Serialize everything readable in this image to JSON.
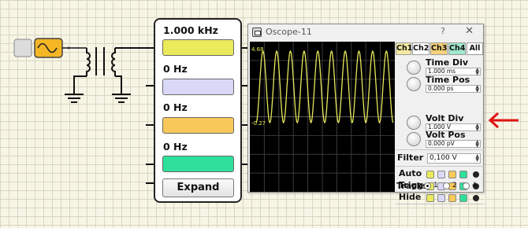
{
  "freq_panel": {
    "channels": [
      {
        "label": "1.000 kHz",
        "color": "#eaea5a"
      },
      {
        "label": "0 Hz",
        "color": "#d9d9f7"
      },
      {
        "label": "0 Hz",
        "color": "#f9c85a"
      },
      {
        "label": "0 Hz",
        "color": "#2ee09a"
      }
    ],
    "expand_label": "Expand"
  },
  "oscope": {
    "title": "Oscope-11",
    "help": "?",
    "close": "✕",
    "screen": {
      "top_value": "4.68",
      "bottom_value": "-0.27",
      "trace_color": "#e5e85a",
      "cycles": 10
    },
    "channels": [
      {
        "label": "Ch1",
        "color": "#f3e9a0"
      },
      {
        "label": "Ch2",
        "color": "#ffffff"
      },
      {
        "label": "Ch3",
        "color": "#f7d27a"
      },
      {
        "label": "Ch4",
        "color": "#9fe8c9"
      },
      {
        "label": "All",
        "color": "#ffffff"
      }
    ],
    "time_div": {
      "label": "Time Div",
      "value": "1.000 ms"
    },
    "time_pos": {
      "label": "Time Pos",
      "value": "0.000 ps"
    },
    "volt_div": {
      "label": "Volt Div",
      "value": "1.000 V"
    },
    "volt_pos": {
      "label": "Volt Pos",
      "value": "0.000 pV"
    },
    "filter": {
      "label": "Filter",
      "value": "0,100 V"
    },
    "rows": [
      {
        "label": "Auto"
      },
      {
        "label": "Trigger"
      },
      {
        "label": "Hide"
      }
    ],
    "square_colors": [
      "#eaea5a",
      "#d9d9f7",
      "#f9c85a",
      "#2ee09a"
    ],
    "tracks": {
      "label": "Tracks",
      "options": [
        "1",
        "2",
        "4"
      ],
      "selected": "1"
    }
  },
  "annotation": {
    "arrow_color": "#e01515"
  }
}
